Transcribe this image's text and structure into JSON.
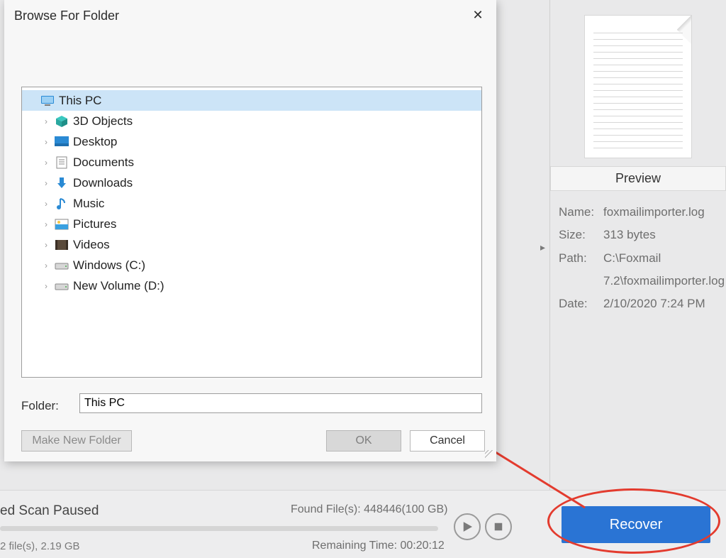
{
  "dialog": {
    "title": "Browse For Folder",
    "folder_label": "Folder:",
    "folder_value": "This PC",
    "btn_new_folder": "Make New Folder",
    "btn_ok": "OK",
    "btn_cancel": "Cancel",
    "tree": [
      {
        "label": "This PC",
        "icon": "pc-icon",
        "expand": "",
        "selected": true
      },
      {
        "label": "3D Objects",
        "icon": "cube-icon",
        "expand": "›",
        "child": true
      },
      {
        "label": "Desktop",
        "icon": "desktop-icon",
        "expand": "›",
        "child": true
      },
      {
        "label": "Documents",
        "icon": "doc-icon",
        "expand": "›",
        "child": true
      },
      {
        "label": "Downloads",
        "icon": "download-icon",
        "expand": "›",
        "child": true
      },
      {
        "label": "Music",
        "icon": "music-icon",
        "expand": "›",
        "child": true
      },
      {
        "label": "Pictures",
        "icon": "pictures-icon",
        "expand": "›",
        "child": true
      },
      {
        "label": "Videos",
        "icon": "videos-icon",
        "expand": "›",
        "child": true
      },
      {
        "label": "Windows (C:)",
        "icon": "drive-icon",
        "expand": "›",
        "child": true
      },
      {
        "label": "New Volume (D:)",
        "icon": "drive-icon",
        "expand": "›",
        "child": true
      }
    ]
  },
  "preview": {
    "button_label": "Preview",
    "name_label": "Name:",
    "name_value": "foxmailimporter.log",
    "size_label": "Size:",
    "size_value": "313 bytes",
    "path_label": "Path:",
    "path_value": "C:\\Foxmail 7.2\\foxmailimporter.log",
    "date_label": "Date:",
    "date_value": "2/10/2020 7:24 PM"
  },
  "status": {
    "title": "ed Scan Paused",
    "found": "Found File(s):  448446(100 GB)",
    "remaining": "Remaining Time:  00:20:12",
    "lower": "2 file(s), 2.19 GB",
    "recover": "Recover"
  }
}
